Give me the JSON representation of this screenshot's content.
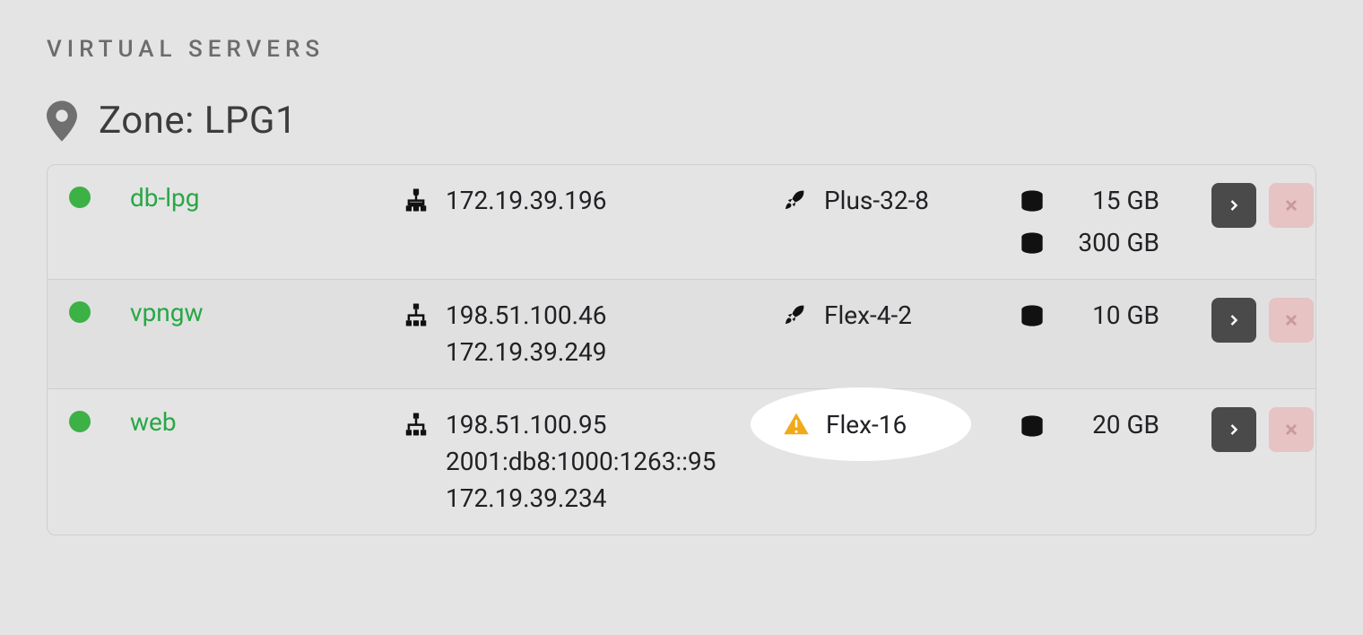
{
  "section_title": "VIRTUAL SERVERS",
  "zone": {
    "label_prefix": "Zone: ",
    "name": "LPG1"
  },
  "servers": [
    {
      "name": "db-lpg",
      "ips": [
        "172.19.39.196"
      ],
      "flavor": "Plus-32-8",
      "flavor_warning": false,
      "disks": [
        "15 GB",
        "300 GB"
      ]
    },
    {
      "name": "vpngw",
      "ips": [
        "198.51.100.46",
        "172.19.39.249"
      ],
      "flavor": "Flex-4-2",
      "flavor_warning": false,
      "disks": [
        "10 GB"
      ]
    },
    {
      "name": "web",
      "ips": [
        "198.51.100.95",
        "2001:db8:1000:1263::95",
        "172.19.39.234"
      ],
      "flavor": "Flex-16",
      "flavor_warning": true,
      "disks": [
        "20 GB"
      ]
    }
  ]
}
